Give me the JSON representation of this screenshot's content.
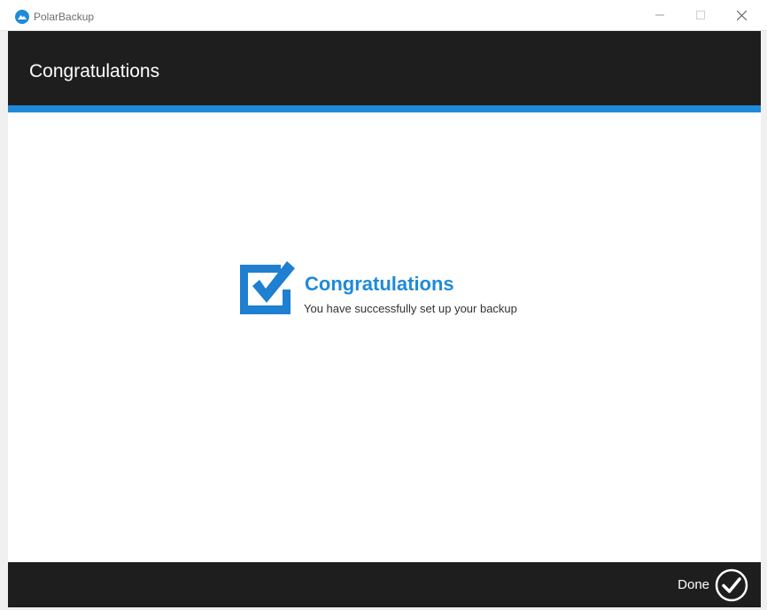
{
  "window": {
    "title": "PolarBackup",
    "icon": "polarbackup-logo-icon",
    "controls": [
      "minimize-icon",
      "maximize-icon",
      "close-icon"
    ]
  },
  "header": {
    "title": "Congratulations"
  },
  "content": {
    "icon": "checkbox-checked-icon",
    "title": "Congratulations",
    "subtitle": "You have successfully set up your backup"
  },
  "footer": {
    "done_label": "Done",
    "done_icon": "check-circle-icon"
  },
  "colors": {
    "accent": "#1f8ad8",
    "header_bg": "#1e1e1e",
    "content_bg": "#ffffff"
  }
}
